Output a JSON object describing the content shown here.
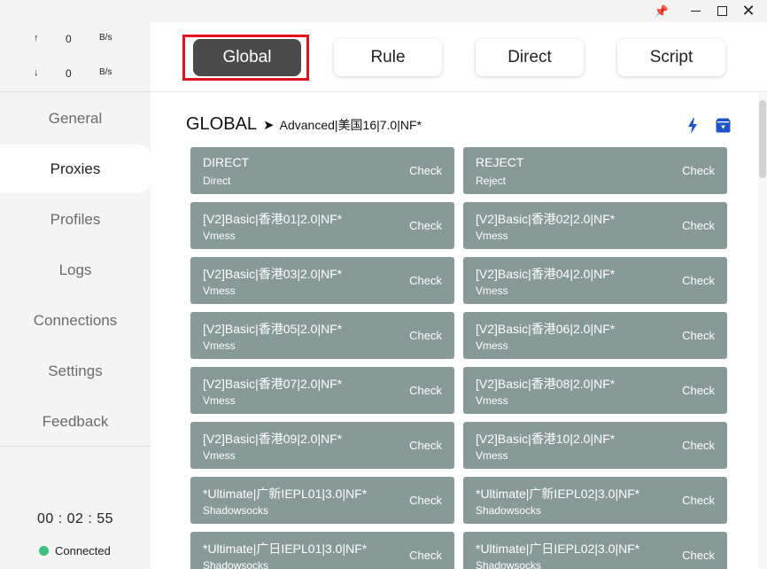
{
  "window": {
    "controls": [
      {
        "name": "pin-icon",
        "glyph": "📌"
      },
      {
        "name": "minimize-icon",
        "glyph": ""
      },
      {
        "name": "maximize-icon",
        "glyph": ""
      },
      {
        "name": "close-icon",
        "glyph": "✕"
      }
    ]
  },
  "traffic": {
    "up": {
      "arrow": "↑",
      "value": "0",
      "unit": "B/s"
    },
    "down": {
      "arrow": "↓",
      "value": "0",
      "unit": "B/s"
    }
  },
  "nav": {
    "items": [
      {
        "label": "General",
        "active": false
      },
      {
        "label": "Proxies",
        "active": true
      },
      {
        "label": "Profiles",
        "active": false
      },
      {
        "label": "Logs",
        "active": false
      },
      {
        "label": "Connections",
        "active": false
      },
      {
        "label": "Settings",
        "active": false
      },
      {
        "label": "Feedback",
        "active": false
      }
    ]
  },
  "status": {
    "timer": "00 : 02 : 55",
    "connection": "Connected",
    "connection_color": "#3fbf7f"
  },
  "modes": {
    "items": [
      {
        "label": "Global",
        "active": true
      },
      {
        "label": "Rule",
        "active": false
      },
      {
        "label": "Direct",
        "active": false
      },
      {
        "label": "Script",
        "active": false
      }
    ],
    "highlight_color": "#e0141a"
  },
  "group": {
    "name": "GLOBAL",
    "arrow": "➤",
    "selected": "Advanced|美国16|7.0|NF*",
    "icons": [
      "bolt-icon",
      "save-icon"
    ],
    "icon_color": "#1f55c7"
  },
  "proxies": {
    "check_label": "Check",
    "card_color": "#879a98",
    "items": [
      {
        "name": "DIRECT",
        "type": "Direct"
      },
      {
        "name": "REJECT",
        "type": "Reject"
      },
      {
        "name": "[V2]Basic|香港01|2.0|NF*",
        "type": "Vmess"
      },
      {
        "name": "[V2]Basic|香港02|2.0|NF*",
        "type": "Vmess"
      },
      {
        "name": "[V2]Basic|香港03|2.0|NF*",
        "type": "Vmess"
      },
      {
        "name": "[V2]Basic|香港04|2.0|NF*",
        "type": "Vmess"
      },
      {
        "name": "[V2]Basic|香港05|2.0|NF*",
        "type": "Vmess"
      },
      {
        "name": "[V2]Basic|香港06|2.0|NF*",
        "type": "Vmess"
      },
      {
        "name": "[V2]Basic|香港07|2.0|NF*",
        "type": "Vmess"
      },
      {
        "name": "[V2]Basic|香港08|2.0|NF*",
        "type": "Vmess"
      },
      {
        "name": "[V2]Basic|香港09|2.0|NF*",
        "type": "Vmess"
      },
      {
        "name": "[V2]Basic|香港10|2.0|NF*",
        "type": "Vmess"
      },
      {
        "name": "*Ultimate|广新IEPL01|3.0|NF*",
        "type": "Shadowsocks"
      },
      {
        "name": "*Ultimate|广新IEPL02|3.0|NF*",
        "type": "Shadowsocks"
      },
      {
        "name": "*Ultimate|广日IEPL01|3.0|NF*",
        "type": "Shadowsocks"
      },
      {
        "name": "*Ultimate|广日IEPL02|3.0|NF*",
        "type": "Shadowsocks"
      }
    ]
  }
}
